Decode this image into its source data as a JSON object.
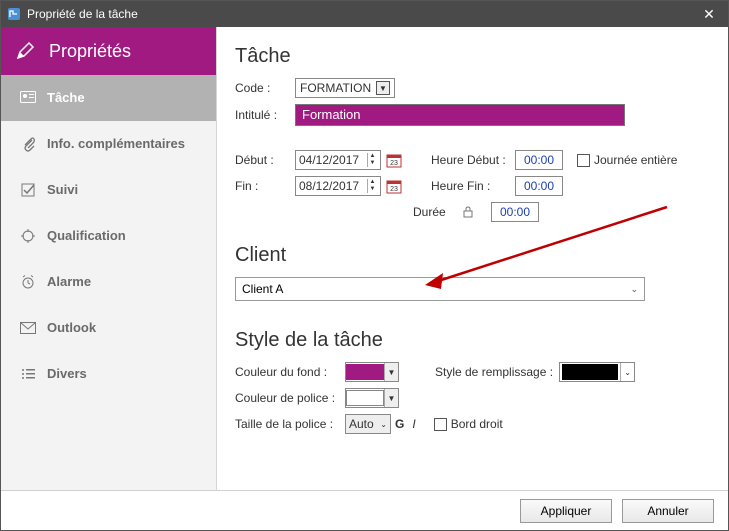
{
  "window": {
    "title": "Propriété de la tâche"
  },
  "sidebar": {
    "header": "Propriétés",
    "items": [
      {
        "label": "Tâche"
      },
      {
        "label": "Info. complémentaires"
      },
      {
        "label": "Suivi"
      },
      {
        "label": "Qualification"
      },
      {
        "label": "Alarme"
      },
      {
        "label": "Outlook"
      },
      {
        "label": "Divers"
      }
    ]
  },
  "sections": {
    "task": {
      "title": "Tâche",
      "code_label": "Code :",
      "code_value": "FORMATION",
      "intitule_label": "Intitulé :",
      "intitule_value": "Formation",
      "debut_label": "Début :",
      "debut_value": "04/12/2017",
      "fin_label": "Fin :",
      "fin_value": "08/12/2017",
      "heure_debut_label": "Heure Début :",
      "heure_debut_value": "00:00",
      "heure_fin_label": "Heure Fin :",
      "heure_fin_value": "00:00",
      "duree_label": "Durée",
      "duree_value": "00:00",
      "allday_label": "Journée entière"
    },
    "client": {
      "title": "Client",
      "value": "Client A"
    },
    "style": {
      "title": "Style de la tâche",
      "bg_label": "Couleur du fond :",
      "bg_color": "#a01a82",
      "font_color_label": "Couleur de police :",
      "font_color": "#ffffff",
      "font_size_label": "Taille de la police :",
      "font_size_value": "Auto",
      "bold_char": "G",
      "italic_char": "I",
      "fill_style_label": "Style de remplissage :",
      "straight_label": "Bord droit"
    }
  },
  "footer": {
    "apply": "Appliquer",
    "cancel": "Annuler"
  }
}
